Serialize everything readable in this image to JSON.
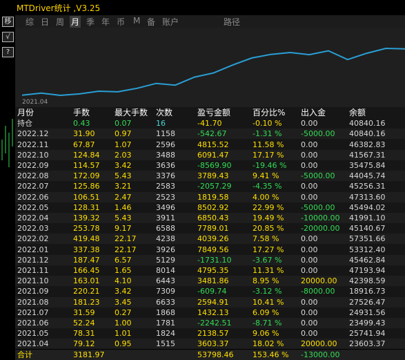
{
  "window": {
    "title": "MTDriver统计 ,V3.25"
  },
  "left_toolbar": {
    "btn1": "移",
    "btn2": "√",
    "btn3": "?"
  },
  "tabs": [
    {
      "label": "综",
      "active": false
    },
    {
      "label": "日",
      "active": false
    },
    {
      "label": "周",
      "active": false
    },
    {
      "label": "月",
      "active": true
    },
    {
      "label": "季",
      "active": false
    },
    {
      "label": "年",
      "active": false
    },
    {
      "label": "币",
      "active": false
    },
    {
      "label": "M",
      "active": false
    },
    {
      "label": "备",
      "active": false
    },
    {
      "label": "账户",
      "active": false
    },
    {
      "label": "路径",
      "active": false
    }
  ],
  "chart_data": {
    "type": "line",
    "x_tick_label": "2021.04",
    "x": [
      "2021.04",
      "2021.05",
      "2021.06",
      "2021.07",
      "2021.08",
      "2021.09",
      "2021.10",
      "2021.11",
      "2021.12",
      "2022.01",
      "2022.02",
      "2022.03",
      "2022.04",
      "2022.05",
      "2022.06",
      "2022.07",
      "2022.08",
      "2022.09",
      "2022.10",
      "2022.11",
      "2022.12"
    ],
    "series": [
      {
        "color": "#2a9fd6",
        "values": [
          3603.37,
          5741.94,
          3499.43,
          4931.56,
          7526.47,
          6918.73,
          10398.59,
          15193.94,
          13462.84,
          21312.4,
          25351.66,
          33140.67,
          39991.1,
          43494.02,
          45313.6,
          43256.31,
          47045.74,
          38475.84,
          44567.31,
          49382.83,
          48840.16
        ]
      }
    ]
  },
  "table": {
    "headers": [
      "月份",
      "手数",
      "最大手数",
      "次数",
      "盈亏金额",
      "百分比%",
      "出入金",
      "余额"
    ],
    "position_row": [
      "持仓",
      "0.43",
      "0.07",
      "16",
      "-41.70",
      "-0.10 %",
      "0.00",
      "40840.16"
    ],
    "rows": [
      [
        "2022.12",
        "31.90",
        "0.97",
        "1158",
        "-542.67",
        "-1.31 %",
        "-5000.00",
        "40840.16"
      ],
      [
        "2022.11",
        "67.87",
        "1.07",
        "2596",
        "4815.52",
        "11.58 %",
        "0.00",
        "46382.83"
      ],
      [
        "2022.10",
        "124.84",
        "2.03",
        "3488",
        "6091.47",
        "17.17 %",
        "0.00",
        "41567.31"
      ],
      [
        "2022.09",
        "114.57",
        "3.42",
        "3636",
        "-8569.90",
        "-19.46 %",
        "0.00",
        "35475.84"
      ],
      [
        "2022.08",
        "172.09",
        "5.43",
        "3376",
        "3789.43",
        "9.41 %",
        "-5000.00",
        "44045.74"
      ],
      [
        "2022.07",
        "125.86",
        "3.21",
        "2583",
        "-2057.29",
        "-4.35 %",
        "0.00",
        "45256.31"
      ],
      [
        "2022.06",
        "106.51",
        "2.47",
        "2523",
        "1819.58",
        "4.00 %",
        "0.00",
        "47313.60"
      ],
      [
        "2022.05",
        "128.31",
        "1.46",
        "3496",
        "8502.92",
        "22.99 %",
        "-5000.00",
        "45494.02"
      ],
      [
        "2022.04",
        "139.32",
        "5.43",
        "3911",
        "6850.43",
        "19.49 %",
        "-10000.00",
        "41991.10"
      ],
      [
        "2022.03",
        "253.78",
        "9.17",
        "6588",
        "7789.01",
        "20.85 %",
        "-20000.00",
        "45140.67"
      ],
      [
        "2022.02",
        "419.48",
        "22.17",
        "4238",
        "4039.26",
        "7.58 %",
        "0.00",
        "57351.66"
      ],
      [
        "2022.01",
        "337.38",
        "22.17",
        "3926",
        "7849.56",
        "17.27 %",
        "0.00",
        "53312.40"
      ],
      [
        "2021.12",
        "187.47",
        "6.57",
        "5129",
        "-1731.10",
        "-3.67 %",
        "0.00",
        "45462.84"
      ],
      [
        "2021.11",
        "166.45",
        "1.65",
        "8014",
        "4795.35",
        "11.31 %",
        "0.00",
        "47193.94"
      ],
      [
        "2021.10",
        "163.01",
        "4.10",
        "6443",
        "3481.86",
        "8.95 %",
        "20000.00",
        "42398.59"
      ],
      [
        "2021.09",
        "220.21",
        "3.42",
        "7309",
        "-609.74",
        "-3.12 %",
        "-8000.00",
        "18916.73"
      ],
      [
        "2021.08",
        "181.23",
        "3.45",
        "6633",
        "2594.91",
        "10.41 %",
        "0.00",
        "27526.47"
      ],
      [
        "2021.07",
        "31.59",
        "0.27",
        "1868",
        "1432.13",
        "6.09 %",
        "0.00",
        "24931.56"
      ],
      [
        "2021.06",
        "52.24",
        "1.00",
        "1781",
        "-2242.51",
        "-8.71 %",
        "0.00",
        "23499.43"
      ],
      [
        "2021.05",
        "78.31",
        "1.01",
        "1824",
        "2138.57",
        "9.06 %",
        "0.00",
        "25741.94"
      ],
      [
        "2021.04",
        "79.12",
        "0.95",
        "1515",
        "3603.37",
        "18.02 %",
        "20000.00",
        "23603.37"
      ]
    ],
    "total_row": [
      "合计",
      "3181.97",
      "",
      "",
      "53798.46",
      "153.46 %",
      "-13000.00",
      ""
    ]
  },
  "colors": {
    "title": "#ffd400",
    "positive": "#ffe000",
    "negative": "#33dd55",
    "line": "#2a9fd6"
  }
}
